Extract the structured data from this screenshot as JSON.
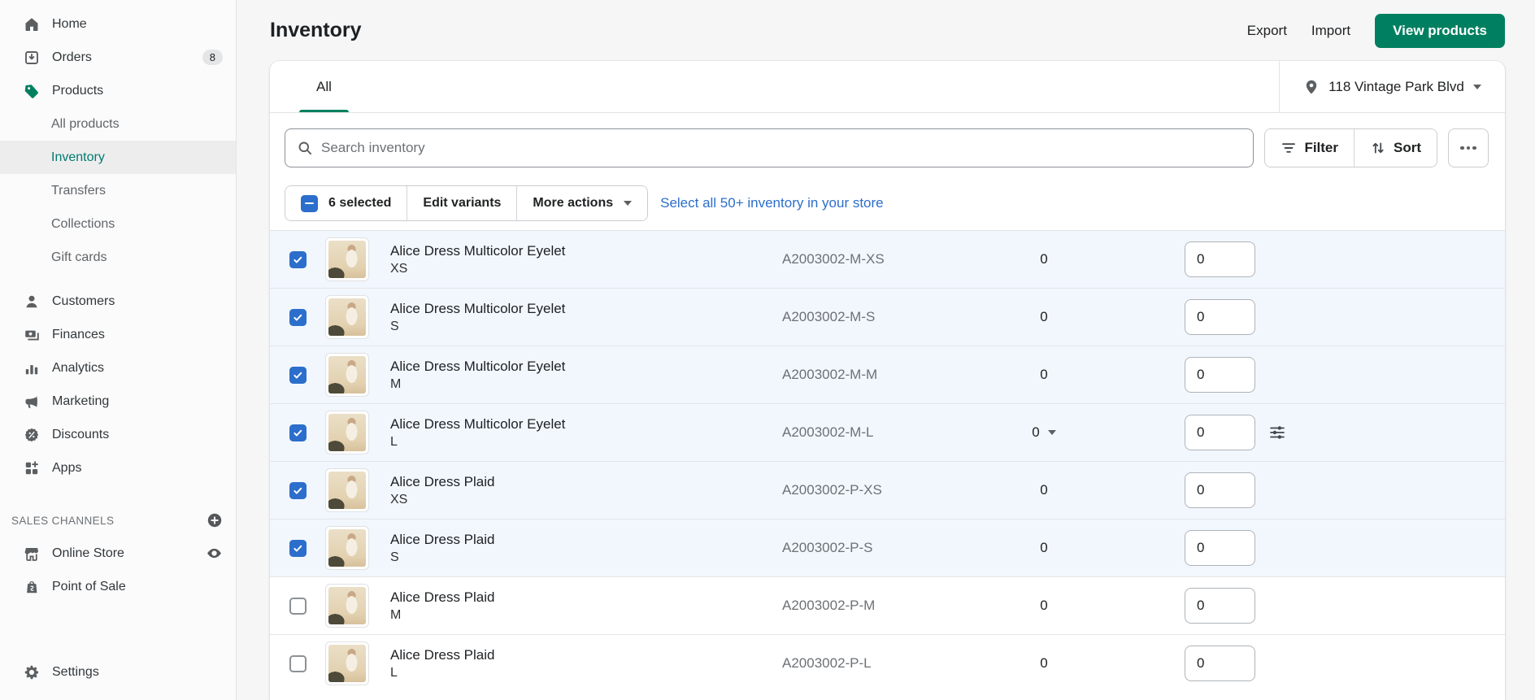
{
  "sidebar": {
    "items": [
      {
        "label": "Home",
        "icon": "home-icon"
      },
      {
        "label": "Orders",
        "icon": "orders-icon",
        "badge": "8"
      },
      {
        "label": "Products",
        "icon": "products-icon"
      },
      {
        "label": "All products"
      },
      {
        "label": "Inventory",
        "active": true
      },
      {
        "label": "Transfers"
      },
      {
        "label": "Collections"
      },
      {
        "label": "Gift cards"
      },
      {
        "label": "Customers",
        "icon": "customers-icon"
      },
      {
        "label": "Finances",
        "icon": "finances-icon"
      },
      {
        "label": "Analytics",
        "icon": "analytics-icon"
      },
      {
        "label": "Marketing",
        "icon": "marketing-icon"
      },
      {
        "label": "Discounts",
        "icon": "discounts-icon"
      },
      {
        "label": "Apps",
        "icon": "apps-icon"
      }
    ],
    "sales_channels": {
      "header": "SALES CHANNELS",
      "channels": [
        {
          "label": "Online Store",
          "icon": "storefront-icon"
        },
        {
          "label": "Point of Sale",
          "icon": "pos-bag-icon"
        }
      ]
    },
    "settings_label": "Settings"
  },
  "header": {
    "title": "Inventory",
    "export_label": "Export",
    "import_label": "Import",
    "view_products_label": "View products"
  },
  "tabs": {
    "all_label": "All"
  },
  "location": {
    "name": "118 Vintage Park Blvd"
  },
  "toolbar": {
    "search_placeholder": "Search inventory",
    "filter_label": "Filter",
    "sort_label": "Sort"
  },
  "bulk": {
    "selected_label": "6 selected",
    "edit_variants_label": "Edit variants",
    "more_actions_label": "More actions",
    "select_all_label": "Select all 50+ inventory in your store"
  },
  "rows": [
    {
      "name": "Alice Dress Multicolor Eyelet",
      "variant": "XS",
      "sku": "A2003002-M-XS",
      "available": "0",
      "input_value": "0",
      "selected": true
    },
    {
      "name": "Alice Dress Multicolor Eyelet",
      "variant": "S",
      "sku": "A2003002-M-S",
      "available": "0",
      "input_value": "0",
      "selected": true
    },
    {
      "name": "Alice Dress Multicolor Eyelet",
      "variant": "M",
      "sku": "A2003002-M-M",
      "available": "0",
      "input_value": "0",
      "selected": true
    },
    {
      "name": "Alice Dress Multicolor Eyelet",
      "variant": "L",
      "sku": "A2003002-M-L",
      "available": "0",
      "input_value": "0",
      "selected": true,
      "has_available_dropdown": true,
      "has_adjust_icon": true
    },
    {
      "name": "Alice Dress Plaid",
      "variant": "XS",
      "sku": "A2003002-P-XS",
      "available": "0",
      "input_value": "0",
      "selected": true
    },
    {
      "name": "Alice Dress Plaid",
      "variant": "S",
      "sku": "A2003002-P-S",
      "available": "0",
      "input_value": "0",
      "selected": true
    },
    {
      "name": "Alice Dress Plaid",
      "variant": "M",
      "sku": "A2003002-P-M",
      "available": "0",
      "input_value": "0",
      "selected": false
    },
    {
      "name": "Alice Dress Plaid",
      "variant": "L",
      "sku": "A2003002-P-L",
      "available": "0",
      "input_value": "0",
      "selected": false
    }
  ],
  "colors": {
    "primary_green": "#008060",
    "active_nav_teal": "#007b70",
    "selection_blue": "#2c6ecb",
    "link_blue": "#2c6ecb",
    "selected_row_bg": "#f2f7fe",
    "page_bg": "#f6f6f7"
  }
}
